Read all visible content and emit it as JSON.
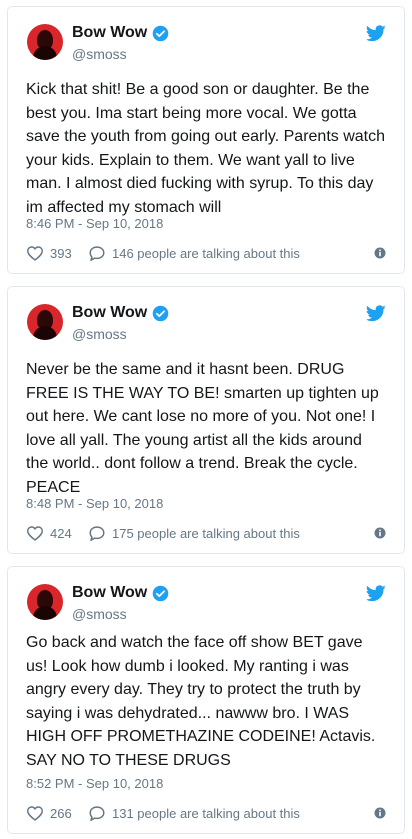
{
  "tweets": [
    {
      "name": "Bow Wow",
      "handle": "@smoss",
      "text": "Kick that shit! Be a good son or daughter. Be the best you. Ima start being more vocal. We gotta save the youth from going out early. Parents watch your kids. Explain to them. We want yall to live man. I almost died fucking with syrup. To this day im affected my stomach will",
      "time": "8:46 PM - Sep 10, 2018",
      "likes": "393",
      "talking": "146 people are talking about this"
    },
    {
      "name": "Bow Wow",
      "handle": "@smoss",
      "text": "Never be the same and it hasnt been. DRUG FREE IS THE WAY TO BE! smarten up tighten up out here. We cant lose no more of you. Not one! I love all yall. The young artist all the kids around the world.. dont follow a trend. Break the cycle. PEACE",
      "time": "8:48 PM - Sep 10, 2018",
      "likes": "424",
      "talking": "175 people are talking about this"
    },
    {
      "name": "Bow Wow",
      "handle": "@smoss",
      "text": "Go back and watch the face off show BET gave us! Look how dumb i looked. My ranting i was angry every day. They try to protect the truth by saying i was dehydrated... nawww bro. I WAS HIGH OFF PROMETHAZINE CODEINE! Actavis. SAY NO TO THESE DRUGS",
      "time": "8:52 PM - Sep 10, 2018",
      "likes": "266",
      "talking": "131 people are talking about this"
    }
  ],
  "colors": {
    "twitter_blue": "#1da1f2",
    "secondary_text": "#657786",
    "border": "#e1e8ed"
  },
  "icons": [
    "twitter-bird-icon",
    "verified-badge-icon",
    "heart-icon",
    "reply-bubble-icon",
    "info-icon"
  ]
}
